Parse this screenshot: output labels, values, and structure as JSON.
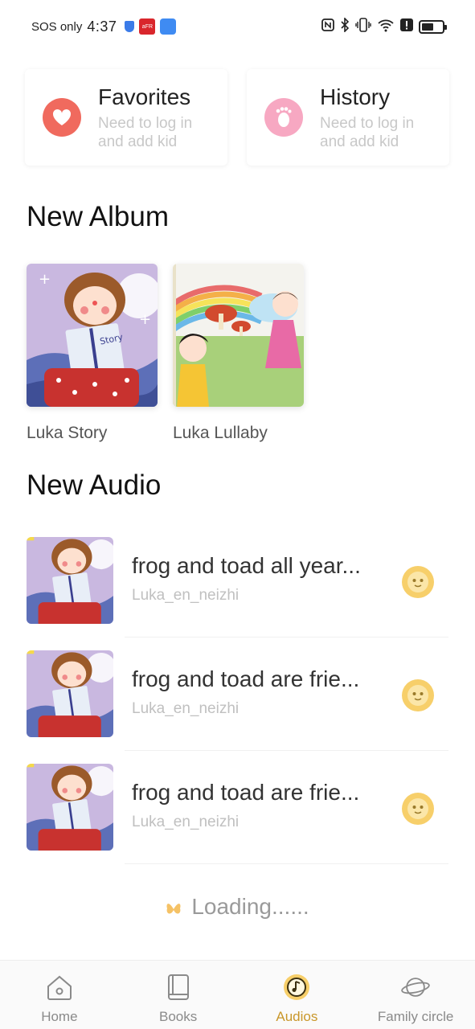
{
  "status_bar": {
    "carrier": "SOS only",
    "time": "4:37",
    "app1_text": "aFR"
  },
  "quick_cards": [
    {
      "title": "Favorites",
      "subtitle": "Need to log in and add kid",
      "icon": "heart-icon"
    },
    {
      "title": "History",
      "subtitle": "Need to log in and add kid",
      "icon": "footprint-icon"
    }
  ],
  "sections": {
    "new_album": "New Album",
    "new_audio": "New Audio"
  },
  "albums": [
    {
      "title": "Luka Story",
      "cover": "story-cover",
      "book_text": "Story"
    },
    {
      "title": "Luka Lullaby",
      "cover": "lullaby-cover"
    }
  ],
  "audios": [
    {
      "title": "frog and toad all year...",
      "author": "Luka_en_neizhi"
    },
    {
      "title": "frog and toad are frie...",
      "author": "Luka_en_neizhi"
    },
    {
      "title": "frog and toad are frie...",
      "author": "Luka_en_neizhi"
    }
  ],
  "loading_text": "Loading......",
  "nav": [
    {
      "label": "Home",
      "icon": "home-icon",
      "active": false
    },
    {
      "label": "Books",
      "icon": "book-icon",
      "active": false
    },
    {
      "label": "Audios",
      "icon": "audio-disc-icon",
      "active": true
    },
    {
      "label": "Family circle",
      "icon": "planet-icon",
      "active": false
    }
  ],
  "colors": {
    "accent": "#c9972a",
    "favorites_icon_bg": "#f06a5e",
    "history_icon_bg": "#f7a8c2",
    "play_button": "#f7cf6a"
  }
}
